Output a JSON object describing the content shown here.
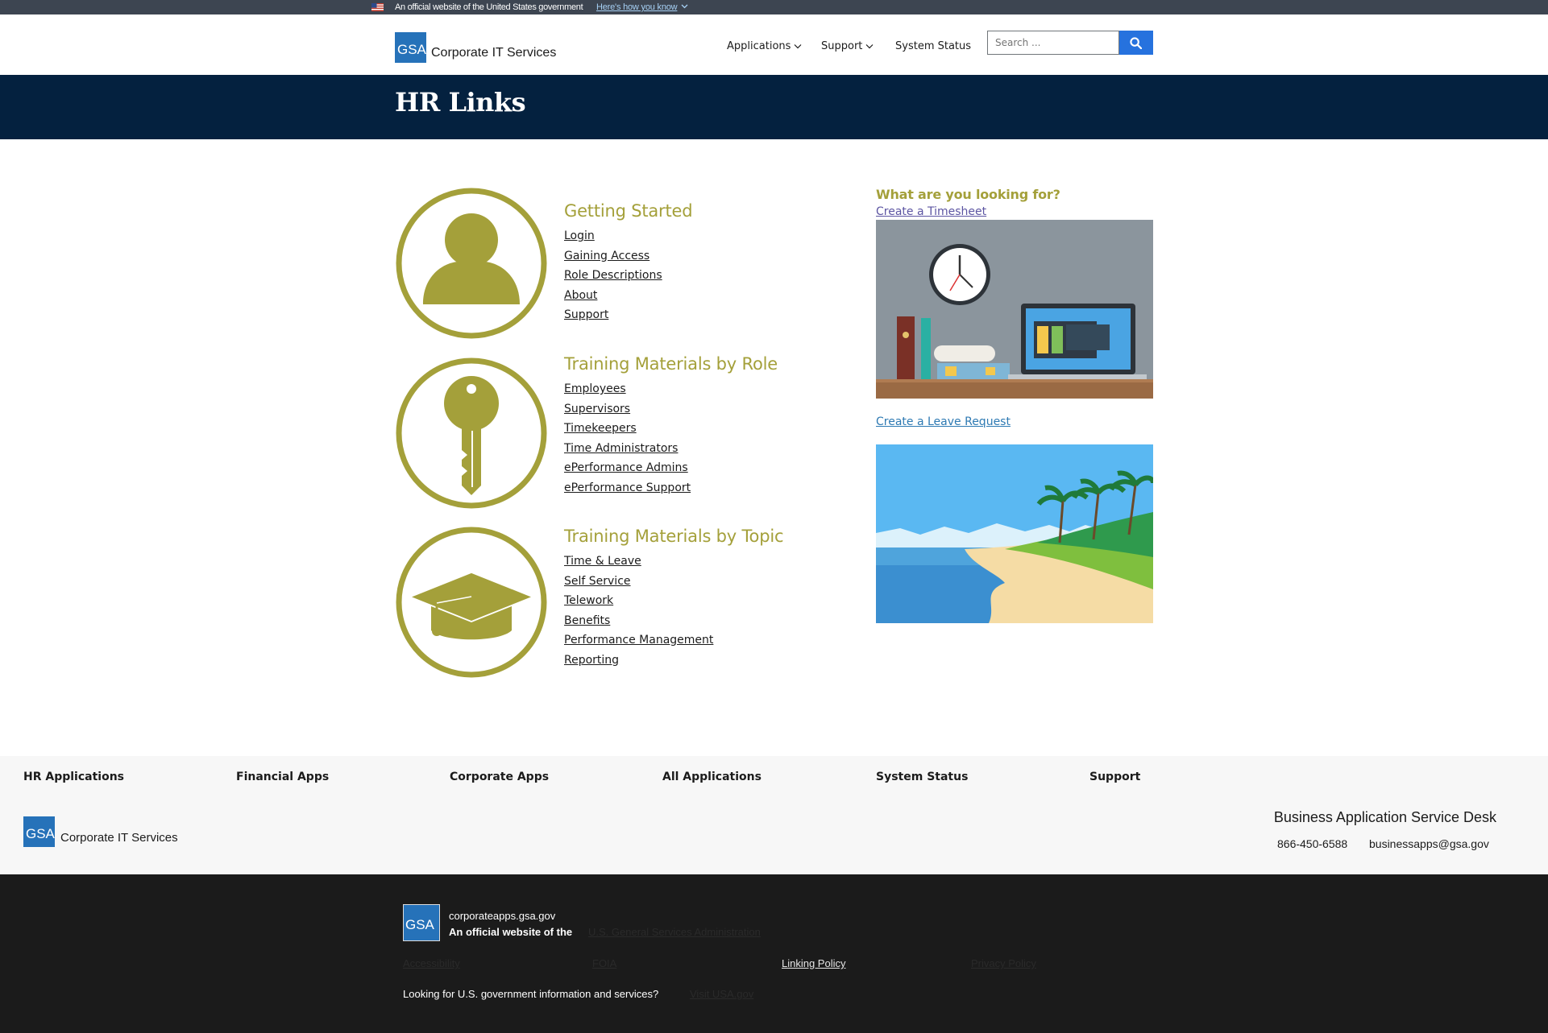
{
  "gov_banner": {
    "text": "An official website of the United States government",
    "how_link": "Here's how you know"
  },
  "header": {
    "logo_text": "GSA",
    "site_name": "Corporate IT Services",
    "nav": [
      {
        "label": "Applications"
      },
      {
        "label": "Support"
      },
      {
        "label": "System Status"
      }
    ],
    "search_placeholder": "Search ..."
  },
  "page_title": "HR Links",
  "sections": [
    {
      "title": "Getting Started",
      "icon": "person-icon",
      "links": [
        "Login",
        "Gaining Access",
        "Role Descriptions",
        "About",
        "Support"
      ]
    },
    {
      "title": "Training Materials by Role",
      "icon": "key-icon",
      "links": [
        "Employees",
        "Supervisors",
        "Timekeepers",
        "Time Administrators",
        "ePerformance Admins",
        "ePerformance Support"
      ]
    },
    {
      "title": "Training Materials by Topic",
      "icon": "graduation-cap-icon",
      "links": [
        "Time & Leave",
        "Self Service",
        "Telework",
        "Benefits",
        "Performance Management",
        "Reporting"
      ]
    }
  ],
  "sidebar": {
    "title": "What are you looking for?",
    "timesheet_link": "Create a Timesheet",
    "leave_link": "Create a Leave Request"
  },
  "footer_nav": [
    "HR Applications",
    "Financial Apps",
    "Corporate Apps",
    "All Applications",
    "System Status",
    "Support"
  ],
  "footer": {
    "logo_text": "GSA",
    "site_name": "Corporate IT Services",
    "desk_title": "Business Application Service Desk",
    "phone": "866-450-6588",
    "email": "businessapps@gsa.gov"
  },
  "identifier": {
    "logo_text": "GSA",
    "domain": "corporateapps.gsa.gov",
    "official": "An official website of the",
    "agency": "U.S. General Services Administration",
    "links": [
      "Accessibility",
      "FOIA",
      "Linking Policy",
      "Privacy Policy"
    ],
    "looking": "Looking for U.S. government information and services?",
    "usa_link": "Visit USA.gov"
  },
  "colors": {
    "olive": "#a4a03a",
    "navy": "#04213f",
    "gsa_blue": "#2672b9",
    "button_blue": "#2672de"
  }
}
